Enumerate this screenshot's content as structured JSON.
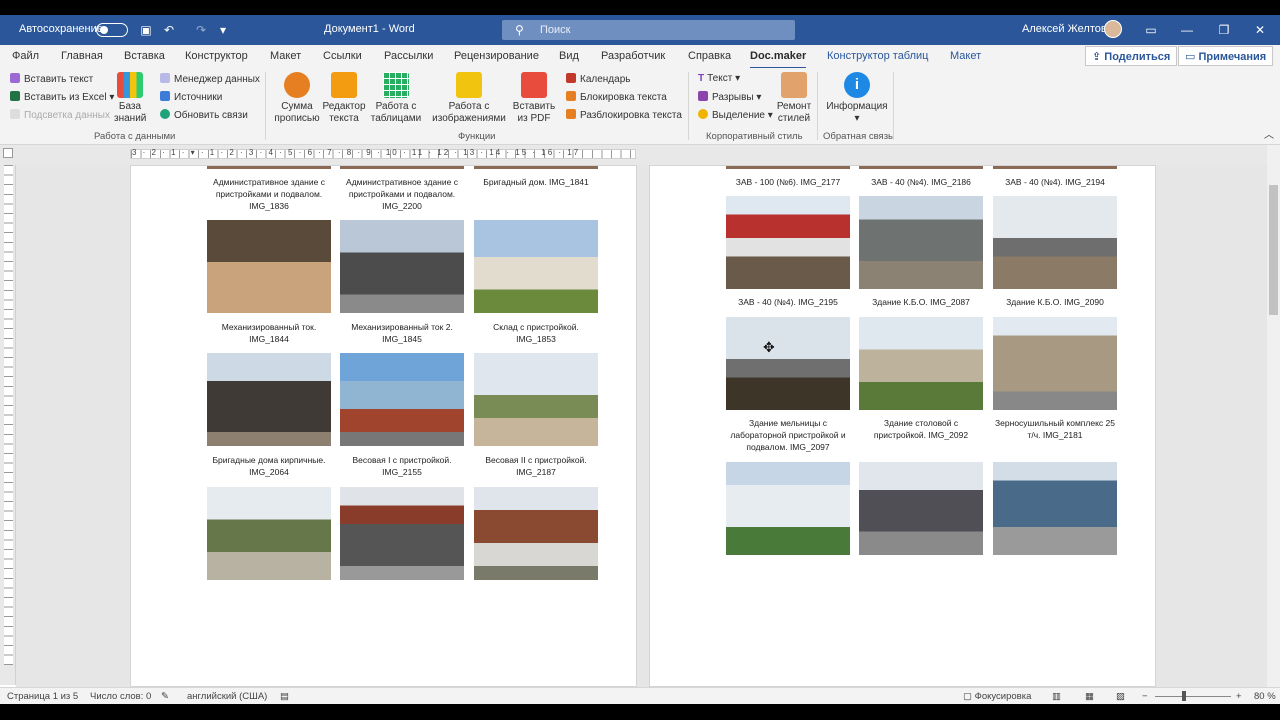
{
  "titlebar": {
    "autosave_label": "Автосохранение",
    "doc_title": "Документ1  -  Word",
    "search_placeholder": "Поиск",
    "user_name": "Алексей Желтов",
    "colors": {
      "bar": "#2b579a"
    }
  },
  "tabs": [
    {
      "label": "Файл"
    },
    {
      "label": "Главная"
    },
    {
      "label": "Вставка"
    },
    {
      "label": "Конструктор"
    },
    {
      "label": "Макет"
    },
    {
      "label": "Ссылки"
    },
    {
      "label": "Рассылки"
    },
    {
      "label": "Рецензирование"
    },
    {
      "label": "Вид"
    },
    {
      "label": "Разработчик"
    },
    {
      "label": "Справка"
    },
    {
      "label": "Doc.maker"
    },
    {
      "label": "Конструктор таблиц"
    },
    {
      "label": "Макет"
    }
  ],
  "share": {
    "share_label": "Поделиться",
    "comments_label": "Примечания"
  },
  "ribbon": {
    "insert_text": "Вставить текст",
    "insert_excel": "Вставить из Excel",
    "highlight_data": "Подсветка данных",
    "knowledge_base": "База знаний",
    "data_manager": "Менеджер данных",
    "sources": "Источники",
    "refresh_links": "Обновить связи",
    "group_data": "Работа с данными",
    "sum_words": "Сумма прописью",
    "text_editor": "Редактор текста",
    "table_work": "Работа с таблицами",
    "image_work": "Работа с изображениями",
    "insert_pdf": "Вставить из PDF",
    "calendar": "Календарь",
    "lock_text": "Блокировка текста",
    "unlock_text": "Разблокировка текста",
    "group_functions": "Функции",
    "text_menu": "Текст",
    "breaks_menu": "Разрывы",
    "select_menu": "Выделение",
    "style_repair": "Ремонт стилей",
    "group_corp": "Корпоративный стиль",
    "info": "Информация",
    "group_feedback": "Обратная связь"
  },
  "ruler": {
    "ticks": "3 · 2 · 1 · ▾ · 1 · 2 · 3 · 4 · 5 · 6 · 7 · 8 · 9 · 10 · 11 · 12 · 13 · 14 · 15 · 16 · 17"
  },
  "page1": {
    "rows": [
      [
        "Административное здание с пристройками и подвалом. IMG_1836",
        "Административное здание с пристройками и подвалом. IMG_2200",
        "Бригадный дом. IMG_1841"
      ],
      [
        "Механизированный ток. IMG_1844",
        "Механизированный ток 2. IMG_1845",
        "Склад с пристройкой. IMG_1853"
      ],
      [
        "Бригадные дома кирпичные. IMG_2064",
        "Весовая I с пристройкой. IMG_2155",
        "Весовая II с пристройкой. IMG_2187"
      ]
    ]
  },
  "page2": {
    "rows": [
      [
        "ЗАВ - 100 (№6). IMG_2177",
        "ЗАВ - 40 (№4). IMG_2186",
        "ЗАВ - 40 (№4). IMG_2194"
      ],
      [
        "ЗАВ - 40 (№4). IMG_2195",
        "Здание К.Б.О. IMG_2087",
        "Здание К.Б.О. IMG_2090"
      ],
      [
        "Здание мельницы с лабораторной пристройкой и подвалом. IMG_2097",
        "Здание столовой с пристройкой. IMG_2092",
        "Зерносушильный комплекс 25 т/ч. IMG_2181"
      ]
    ]
  },
  "status": {
    "page": "Страница 1 из 5",
    "words": "Число слов: 0",
    "lang": "английский (США)",
    "focus": "Фокусировка",
    "zoom": "80 %"
  }
}
